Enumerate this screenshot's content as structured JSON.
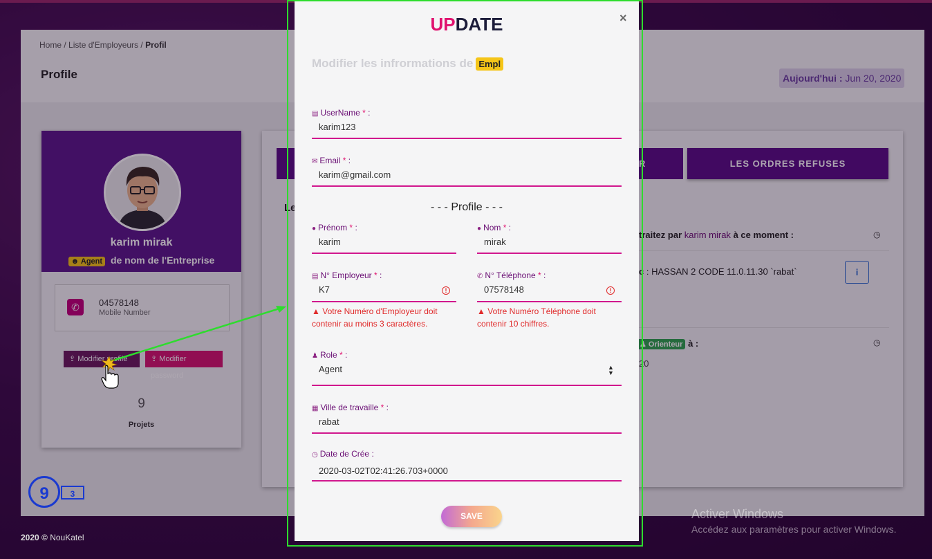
{
  "breadcrumb": {
    "home": "Home",
    "sep": "/",
    "list": "Liste d'Employeurs",
    "current": "Profil"
  },
  "page_title": "Profile",
  "today": {
    "label": "Aujourd'hui :",
    "date": "Jun 20, 2020"
  },
  "profile_card": {
    "name": "karim mirak",
    "role_badge": "Agent",
    "company": "de nom de l'Entreprise",
    "phone": "04578148",
    "phone_label": "Mobile Number",
    "btn_modify_profile": "Modifier profile",
    "btn_modify_password": "Modifier password",
    "projects_count": "9",
    "projects_label": "Projets"
  },
  "tabs": {
    "middle_fragment": "R",
    "refused": "LES ORDRES REFUSES"
  },
  "bg_content": {
    "left_fragment": "Le",
    "traitez_prefix": "traitez par",
    "traitez_name": "karim mirak",
    "traitez_suffix": "à ce moment :",
    "order_line": ": HASSAN 2 CODE 11.0.11.30 `rabat`",
    "order_prefix": "c",
    "orient_badge": "Orienteur",
    "orient_suffix": "à :",
    "year_frag": "20"
  },
  "footer": {
    "copyright": "2020 ©",
    "brand": "NouKatel"
  },
  "overlay_marks": {
    "circle": "9",
    "box": "3"
  },
  "windows": {
    "line1": "Activer Windows",
    "line2": "Accédez aux paramètres pour activer Windows."
  },
  "modal": {
    "title_a": "UP",
    "title_b": "DATE",
    "close": "×",
    "subtitle": "Modifier les infrormations de",
    "subtitle_badge": "Empl",
    "section_profile": "- - - Profile - - -",
    "fields": {
      "username": {
        "label": "UserName",
        "value": "karim123"
      },
      "email": {
        "label": "Email",
        "value": "karim@gmail.com"
      },
      "prenom": {
        "label": "Prénom",
        "value": "karim"
      },
      "nom": {
        "label": "Nom",
        "value": "mirak"
      },
      "n_employeur": {
        "label": "N° Employeur",
        "value": "K7",
        "error": "Votre Numéro d'Employeur doit contenir au moins 3 caractères."
      },
      "n_telephone": {
        "label": "N° Téléphone",
        "value": "07578148",
        "error": "Votre Numéro Téléphone doit contenir 10 chiffres."
      },
      "role": {
        "label": "Role",
        "value": "Agent"
      },
      "ville": {
        "label": "Ville de travaille",
        "value": "rabat"
      },
      "date": {
        "label": "Date de Crée :",
        "value": "2020-03-02T02:41:26.703+0000"
      }
    },
    "required_mark": "*",
    "colon": ":",
    "save": "SAVE"
  },
  "colors": {
    "brand_purple": "#5a0f86",
    "accent_pink": "#d1168d",
    "error": "#e02b2b",
    "annotation_green": "#2edc2e"
  }
}
